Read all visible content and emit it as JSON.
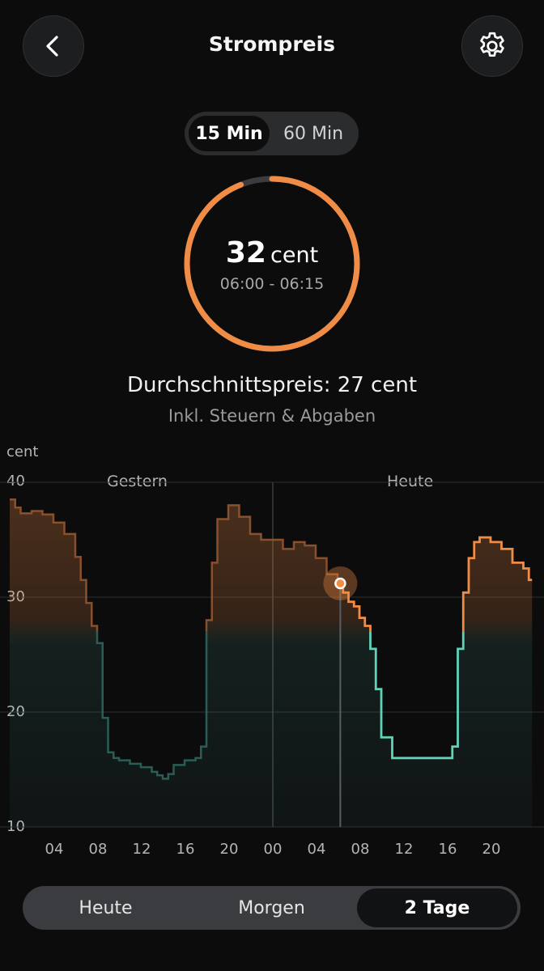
{
  "header": {
    "title": "Strompreis",
    "back_icon": "chevron-left-icon",
    "settings_icon": "gear-icon"
  },
  "interval_toggle": {
    "options": [
      "15 Min",
      "60 Min"
    ],
    "selected": "15 Min"
  },
  "current_price": {
    "value": "32",
    "unit": "cent",
    "time_range": "06:00 - 06:15",
    "ring_fraction": 0.94,
    "ring_color": "#f08c45",
    "ring_track_color": "#3a3c3f"
  },
  "average": {
    "text": "Durchschnittspreis: 27 cent",
    "note": "Inkl. Steuern & Abgaben"
  },
  "chart_data": {
    "type": "line",
    "ylabel": "cent",
    "ylim": [
      10,
      40
    ],
    "y_ticks": [
      "40",
      "30",
      "20",
      "10"
    ],
    "day_labels": [
      "Gestern",
      "Heute"
    ],
    "x_tick_labels": [
      "04",
      "08",
      "12",
      "16",
      "20",
      "00",
      "04",
      "08",
      "12",
      "16",
      "20"
    ],
    "threshold": 27,
    "colors": {
      "high": "#f08c45",
      "low": "#5fd3b8",
      "high_dim": "#9a5a32",
      "low_dim": "#2f6b62"
    },
    "current_point": {
      "hour": 30.25,
      "value": 31.2
    },
    "series": [
      {
        "x": [
          0,
          0.5,
          1,
          2,
          3,
          4,
          5,
          6,
          6.5,
          7,
          7.5,
          8,
          8.5,
          9,
          9.5,
          10,
          11,
          12,
          13,
          13.5,
          14,
          14.5,
          15,
          16,
          17,
          17.5,
          18,
          18.5,
          19,
          20,
          21,
          22,
          23,
          24,
          25,
          26,
          27,
          28,
          29,
          30,
          30.25,
          30.5,
          31,
          31.5,
          32,
          32.5,
          33,
          33.5,
          34,
          35,
          36,
          37,
          38,
          39,
          40,
          40.5,
          41,
          41.5,
          42,
          42.5,
          43,
          44,
          45,
          46,
          47,
          47.5
        ],
        "values": [
          38.5,
          37.8,
          37.3,
          37.5,
          37.2,
          36.5,
          35.5,
          33.5,
          31.5,
          29.5,
          27.5,
          26,
          19.5,
          16.5,
          16,
          15.8,
          15.5,
          15.2,
          14.8,
          14.5,
          14.2,
          14.6,
          15.4,
          15.8,
          16,
          17,
          28,
          33,
          36.8,
          38,
          37,
          35.5,
          35,
          35,
          34.2,
          34.8,
          34.5,
          33.4,
          32,
          31.2,
          31.2,
          30.4,
          29.6,
          29.2,
          28.2,
          27.5,
          25.5,
          22,
          17.8,
          16,
          16,
          16,
          16,
          16,
          16,
          17,
          25.5,
          30.4,
          33.4,
          34.8,
          35.2,
          34.8,
          34.2,
          33,
          32.5,
          31.5
        ]
      }
    ]
  },
  "range_selector": {
    "options": [
      "Heute",
      "Morgen",
      "2 Tage"
    ],
    "selected": "2 Tage"
  }
}
